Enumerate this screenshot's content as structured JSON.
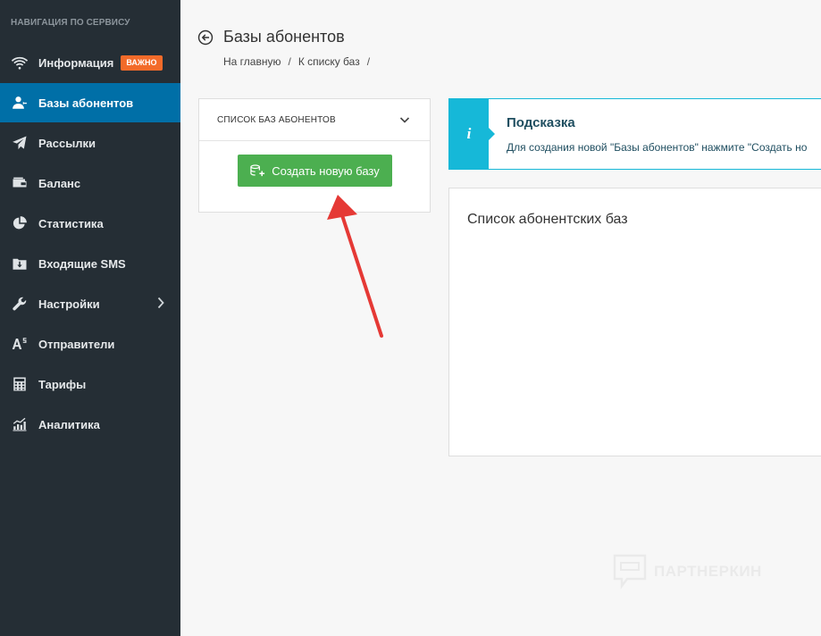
{
  "sidebar": {
    "title": "НАВИГАЦИЯ ПО СЕРВИСУ",
    "items": [
      {
        "label": "Информация",
        "icon": "wifi-icon",
        "badge": "ВАЖНО"
      },
      {
        "label": "Базы абонентов",
        "icon": "users-icon",
        "active": true
      },
      {
        "label": "Рассылки",
        "icon": "paper-plane-icon"
      },
      {
        "label": "Баланс",
        "icon": "wallet-icon"
      },
      {
        "label": "Статистика",
        "icon": "pie-chart-icon"
      },
      {
        "label": "Входящие SMS",
        "icon": "inbox-download-icon"
      },
      {
        "label": "Настройки",
        "icon": "wrench-icon",
        "has_submenu": true
      },
      {
        "label": "Отправители",
        "icon": "sender-text-icon"
      },
      {
        "label": "Тарифы",
        "icon": "calculator-icon"
      },
      {
        "label": "Аналитика",
        "icon": "analytics-chart-icon"
      }
    ],
    "active_color": "#006fa7",
    "badge_color": "#f36b2a"
  },
  "header": {
    "title": "Базы абонентов",
    "breadcrumb": [
      "На главную",
      "/",
      "К списку баз",
      "/"
    ]
  },
  "left_panel": {
    "header": "СПИСОК БАЗ АБОНЕНТОВ",
    "create_button": "Создать новую базу",
    "button_color": "#4caf50"
  },
  "hint": {
    "icon": "i",
    "title": "Подсказка",
    "text": "Для создания новой \"Базы абонентов\" нажмите \"Создать но",
    "accent_color": "#16b8d8"
  },
  "main_card": {
    "title": "Список абонентских баз"
  },
  "watermark": {
    "text": "ПАРТНЕРКИН"
  },
  "annotation": {
    "arrow_color": "#e53935"
  }
}
